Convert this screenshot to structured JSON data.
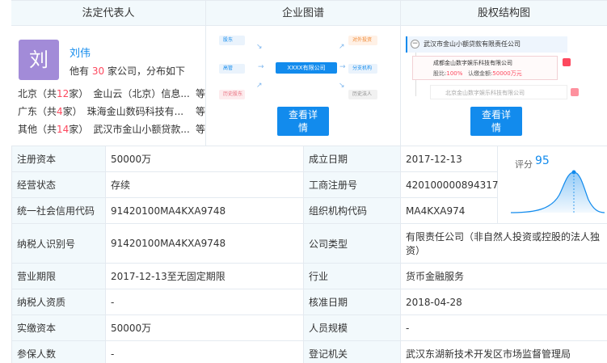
{
  "panels": {
    "rep_title": "法定代表人",
    "graph_title": "企业图谱",
    "equity_title": "股权结构图"
  },
  "rep": {
    "avatar": "刘",
    "name": "刘伟",
    "summary_pre": "他有",
    "count": "30",
    "summary_post": "家公司，分布如下",
    "locations": [
      {
        "pre": "北京（共",
        "num": "12",
        "post": "家）",
        "company": "金山云（北京）信息...",
        "more": "等"
      },
      {
        "pre": "广东（共",
        "num": "4",
        "post": "家）",
        "company": "珠海金山数码科技有...",
        "more": "等"
      },
      {
        "pre": "其他（共",
        "num": "14",
        "post": "家）",
        "company": "武汉市金山小额贷款...",
        "more": "等"
      }
    ]
  },
  "graph": {
    "center": "XXXX有限公司",
    "left": [
      "股东",
      "高管",
      "历史股东"
    ],
    "right": [
      "对外投资",
      "分支机构",
      "历史法人"
    ],
    "button": "查看详\n情"
  },
  "equity": {
    "root": "武汉市金山小额贷款有限责任公司",
    "child_name": "成都金山数字娱乐科技有限公司",
    "child_ratio_label": "股比:",
    "child_ratio": "100%",
    "child_cap_label": "认缴金额:",
    "child_cap": "50000万元",
    "child2": "北京金山数字娱乐科技有限公司",
    "button": "查看详\n情"
  },
  "info": {
    "rows": [
      {
        "k1": "注册资本",
        "v1": "50000万",
        "k2": "成立日期",
        "v2": "2017-12-13"
      },
      {
        "k1": "经营状态",
        "v1": "存续",
        "k2": "工商注册号",
        "v2": "420100000894317"
      },
      {
        "k1": "统一社会信用代码",
        "v1": "91420100MA4KXA9748",
        "k2": "组织机构代码",
        "v2": "MA4KXA974"
      },
      {
        "k1": "纳税人识别号",
        "v1": "91420100MA4KXA9748",
        "k2": "公司类型",
        "v2": "有限责任公司（非自然人投资或控股的法人独资）"
      },
      {
        "k1": "营业期限",
        "v1": "2017-12-13至无固定期限",
        "k2": "行业",
        "v2": "货币金融服务"
      },
      {
        "k1": "纳税人资质",
        "v1": "-",
        "k2": "核准日期",
        "v2": "2018-04-28"
      },
      {
        "k1": "实缴资本",
        "v1": "50000万",
        "k2": "人员规模",
        "v2": "-"
      },
      {
        "k1": "参保人数",
        "v1": "-",
        "k2": "登记机关",
        "v2": "武汉东湖新技术开发区市场监督管理局"
      }
    ],
    "score_label": "评分",
    "score": "95"
  },
  "colors": {
    "accent": "#128bed",
    "highlight": "#fd485e",
    "header_bg": "#f2f9fc"
  }
}
